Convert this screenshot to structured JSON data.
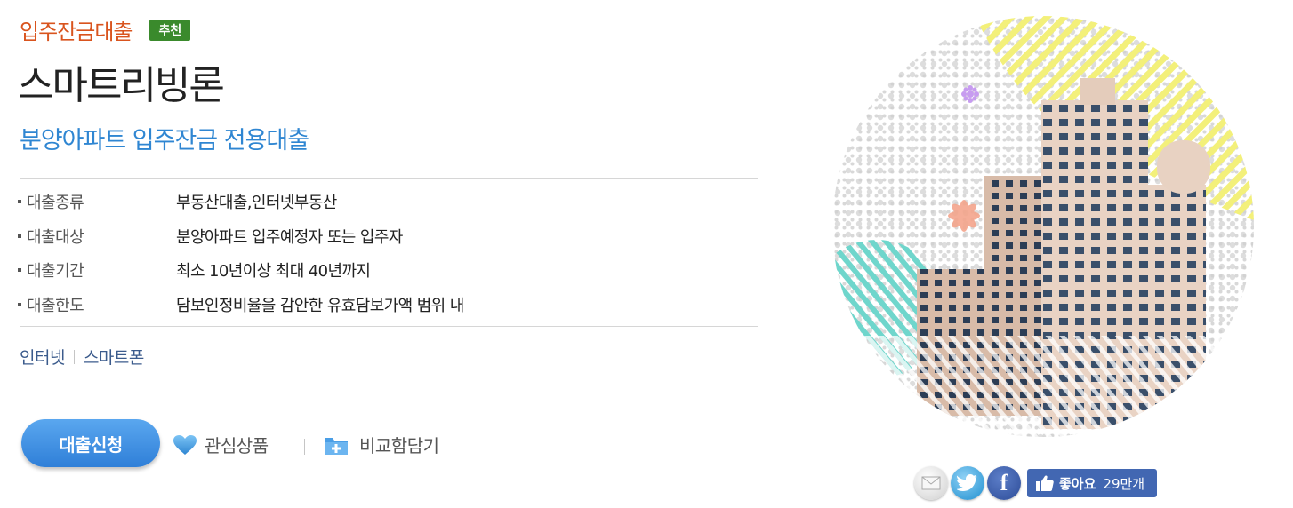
{
  "product": {
    "category": "입주잔금대출",
    "badge": "추천",
    "title": "스마트리빙론",
    "subtitle": "분양아파트 입주잔금 전용대출"
  },
  "specs": [
    {
      "key": "대출종류",
      "value": "부동산대출,인터넷부동산"
    },
    {
      "key": "대출대상",
      "value": "분양아파트 입주예정자 또는 입주자"
    },
    {
      "key": "대출기간",
      "value": "최소 10년이상 최대 40년까지"
    },
    {
      "key": "대출한도",
      "value": "담보인정비율을 감안한 유효담보가액 범위 내"
    }
  ],
  "channels": [
    "인터넷",
    "스마트폰"
  ],
  "actions": {
    "apply_label": "대출신청",
    "wish_label": "관심상품",
    "compare_label": "비교함담기"
  },
  "social": {
    "like_label": "좋아요",
    "like_count": "29만개"
  },
  "colors": {
    "category": "#d9541e",
    "badge_bg": "#3a8a2c",
    "subtitle": "#2f86d2",
    "button": "#3a8be0",
    "facebook": "#4267b2"
  },
  "icons": {
    "wish": "heart-icon",
    "compare": "folder-plus-icon",
    "mail": "mail-icon",
    "twitter": "twitter-icon",
    "facebook": "facebook-icon",
    "like": "thumbs-up-icon"
  }
}
